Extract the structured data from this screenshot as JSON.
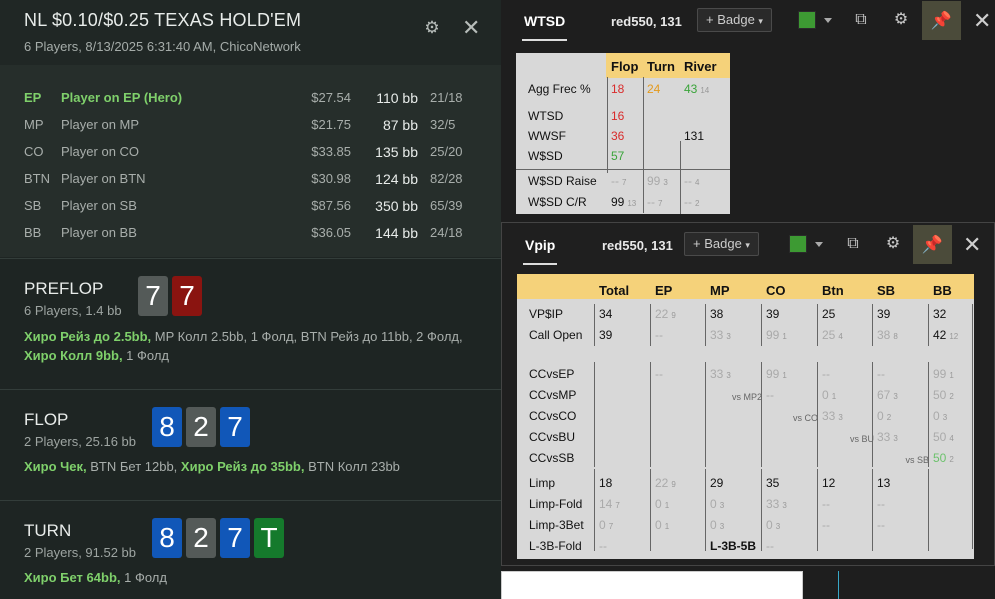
{
  "hand": {
    "title": "NL $0.10/$0.25 TEXAS HOLD'EM",
    "subtitle": "6 Players, 8/13/2025 6:31:40 AM, ChicoNetwork",
    "players": [
      {
        "pos": "EP",
        "name": "Player on EP (Hero)",
        "money": "$27.54",
        "bb": "110 bb",
        "stat": "21/18",
        "hero": true
      },
      {
        "pos": "MP",
        "name": "Player on MP",
        "money": "$21.75",
        "bb": "87 bb",
        "stat": "32/5",
        "hero": false
      },
      {
        "pos": "CO",
        "name": "Player on CO",
        "money": "$33.85",
        "bb": "135 bb",
        "stat": "25/20",
        "hero": false
      },
      {
        "pos": "BTN",
        "name": "Player on BTN",
        "money": "$30.98",
        "bb": "124 bb",
        "stat": "82/28",
        "hero": false
      },
      {
        "pos": "SB",
        "name": "Player on SB",
        "money": "$87.56",
        "bb": "350 bb",
        "stat": "65/39",
        "hero": false
      },
      {
        "pos": "BB",
        "name": "Player on BB",
        "money": "$36.05",
        "bb": "144 bb",
        "stat": "24/18",
        "hero": false
      }
    ],
    "streets": [
      {
        "name": "PREFLOP",
        "sub": "6 Players, 1.4 bb",
        "cards": [
          {
            "v": "7",
            "c": "gray"
          },
          {
            "v": "7",
            "c": "red"
          }
        ],
        "actions": [
          [
            {
              "t": "Хиро Рейз до 2.5bb,",
              "h": true
            },
            {
              "t": " MP Колл 2.5bb, 1 Фолд, BTN Рейз до 11bb, 2 Фолд,",
              "h": false
            }
          ],
          [
            {
              "t": "Хиро Колл 9bb,",
              "h": true
            },
            {
              "t": " 1 Фолд",
              "h": false
            }
          ]
        ]
      },
      {
        "name": "FLOP",
        "sub": "2 Players, 25.16 bb",
        "cards": [
          {
            "v": "8",
            "c": "blue"
          },
          {
            "v": "2",
            "c": "gray"
          },
          {
            "v": "7",
            "c": "blue"
          }
        ],
        "actions": [
          [
            {
              "t": "Хиро Чек,",
              "h": true
            },
            {
              "t": " BTN Бет 12bb, ",
              "h": false
            },
            {
              "t": "Хиро Рейз до 35bb,",
              "h": true
            },
            {
              "t": " BTN Колл 23bb",
              "h": false
            }
          ]
        ]
      },
      {
        "name": "TURN",
        "sub": "2 Players, 91.52 bb",
        "cards": [
          {
            "v": "8",
            "c": "blue"
          },
          {
            "v": "2",
            "c": "gray"
          },
          {
            "v": "7",
            "c": "blue"
          },
          {
            "v": "T",
            "c": "green"
          }
        ],
        "actions": [
          [
            {
              "t": "Хиро Бет 64bb,",
              "h": true
            },
            {
              "t": " 1 Фолд",
              "h": false
            }
          ]
        ]
      }
    ]
  },
  "wtsd": {
    "tab": "WTSD",
    "player": "red550, 131",
    "badge": "+ Badge",
    "headers": [
      "Flop",
      "Turn",
      "River"
    ],
    "rows": [
      {
        "label": "Agg Frec %",
        "cells": [
          {
            "v": "18",
            "s": "",
            "c": "red"
          },
          {
            "v": "24",
            "s": "",
            "c": "orange"
          },
          {
            "v": "43",
            "s": "14",
            "c": "green"
          }
        ]
      },
      {
        "label": "WTSD",
        "cells": [
          {
            "v": "16",
            "s": "",
            "c": "red"
          },
          {
            "v": "",
            "s": "",
            "c": ""
          },
          {
            "v": "",
            "s": "",
            "c": ""
          }
        ]
      },
      {
        "label": "WWSF",
        "cells": [
          {
            "v": "36",
            "s": "",
            "c": "red"
          },
          {
            "v": "",
            "s": "",
            "c": ""
          },
          {
            "v": "131",
            "s": "",
            "c": ""
          }
        ]
      },
      {
        "label": "W$SD",
        "cells": [
          {
            "v": "57",
            "s": "",
            "c": "green"
          },
          {
            "v": "",
            "s": "",
            "c": ""
          },
          {
            "v": "",
            "s": "",
            "c": ""
          }
        ]
      },
      {
        "label": "W$SD Raise",
        "cells": [
          {
            "v": "--",
            "s": "7",
            "c": "gray"
          },
          {
            "v": "99",
            "s": "3",
            "c": "gray"
          },
          {
            "v": "--",
            "s": "4",
            "c": "gray"
          }
        ]
      },
      {
        "label": "W$SD C/R",
        "cells": [
          {
            "v": "99",
            "s": "13",
            "c": ""
          },
          {
            "v": "--",
            "s": "7",
            "c": "gray"
          },
          {
            "v": "--",
            "s": "2",
            "c": "gray"
          }
        ]
      }
    ]
  },
  "vpip": {
    "tab": "Vpip",
    "player": "red550, 131",
    "badge": "+ Badge",
    "headers": [
      "Total",
      "EP",
      "MP",
      "CO",
      "Btn",
      "SB",
      "BB"
    ],
    "rows": [
      {
        "label": "VP$IP",
        "cells": [
          {
            "v": "34",
            "s": "",
            "g": false
          },
          {
            "v": "22",
            "s": "9",
            "g": true
          },
          {
            "v": "38",
            "s": "",
            "g": false
          },
          {
            "v": "39",
            "s": "",
            "g": false
          },
          {
            "v": "25",
            "s": "",
            "g": false
          },
          {
            "v": "39",
            "s": "",
            "g": false
          },
          {
            "v": "32",
            "s": "",
            "g": false
          }
        ]
      },
      {
        "label": "Call Open",
        "cells": [
          {
            "v": "39",
            "s": "",
            "g": false
          },
          {
            "v": "--",
            "s": "",
            "g": true
          },
          {
            "v": "33",
            "s": "3",
            "g": true
          },
          {
            "v": "99",
            "s": "1",
            "g": true
          },
          {
            "v": "25",
            "s": "4",
            "g": true
          },
          {
            "v": "38",
            "s": "8",
            "g": true
          },
          {
            "v": "42",
            "s": "12",
            "g": false
          }
        ]
      },
      {
        "label": "CCvsEP",
        "cells": [
          {
            "v": "",
            "s": "",
            "g": false
          },
          {
            "v": "--",
            "s": "",
            "g": true
          },
          {
            "v": "33",
            "s": "3",
            "g": true
          },
          {
            "v": "99",
            "s": "1",
            "g": true
          },
          {
            "v": "--",
            "s": "",
            "g": true
          },
          {
            "v": "--",
            "s": "",
            "g": true
          },
          {
            "v": "99",
            "s": "1",
            "g": true
          }
        ]
      },
      {
        "label": "CCvsMP",
        "cells": [
          {
            "v": "",
            "s": "",
            "g": false
          },
          {
            "v": "",
            "s": "",
            "g": false
          },
          {
            "v": "vs MP2",
            "s": "",
            "g": false,
            "note": true
          },
          {
            "v": "--",
            "s": "",
            "g": true
          },
          {
            "v": "0",
            "s": "1",
            "g": true
          },
          {
            "v": "67",
            "s": "3",
            "g": true
          },
          {
            "v": "50",
            "s": "2",
            "g": true
          }
        ]
      },
      {
        "label": "CCvsCO",
        "cells": [
          {
            "v": "",
            "s": "",
            "g": false
          },
          {
            "v": "",
            "s": "",
            "g": false
          },
          {
            "v": "",
            "s": "",
            "g": false
          },
          {
            "v": "vs CO",
            "s": "",
            "g": false,
            "note": true
          },
          {
            "v": "33",
            "s": "3",
            "g": true
          },
          {
            "v": "0",
            "s": "2",
            "g": true
          },
          {
            "v": "0",
            "s": "3",
            "g": true
          }
        ]
      },
      {
        "label": "CCvsBU",
        "cells": [
          {
            "v": "",
            "s": "",
            "g": false
          },
          {
            "v": "",
            "s": "",
            "g": false
          },
          {
            "v": "",
            "s": "",
            "g": false
          },
          {
            "v": "",
            "s": "",
            "g": false
          },
          {
            "v": "vs BU",
            "s": "",
            "g": false,
            "note": true
          },
          {
            "v": "33",
            "s": "3",
            "g": true
          },
          {
            "v": "50",
            "s": "4",
            "g": true
          }
        ]
      },
      {
        "label": "CCvsSB",
        "cells": [
          {
            "v": "",
            "s": "",
            "g": false
          },
          {
            "v": "",
            "s": "",
            "g": false
          },
          {
            "v": "",
            "s": "",
            "g": false
          },
          {
            "v": "",
            "s": "",
            "g": false
          },
          {
            "v": "",
            "s": "",
            "g": false
          },
          {
            "v": "vs SB",
            "s": "",
            "g": false,
            "note": true
          },
          {
            "v": "50",
            "s": "2",
            "g": true,
            "green": true
          }
        ]
      },
      {
        "label": "Limp",
        "cells": [
          {
            "v": "18",
            "s": "",
            "g": false
          },
          {
            "v": "22",
            "s": "9",
            "g": true
          },
          {
            "v": "29",
            "s": "",
            "g": false
          },
          {
            "v": "35",
            "s": "",
            "g": false
          },
          {
            "v": "12",
            "s": "",
            "g": false
          },
          {
            "v": "13",
            "s": "",
            "g": false
          },
          {
            "v": "",
            "s": "",
            "g": false
          }
        ]
      },
      {
        "label": "Limp-Fold",
        "cells": [
          {
            "v": "14",
            "s": "7",
            "g": true
          },
          {
            "v": "0",
            "s": "1",
            "g": true
          },
          {
            "v": "0",
            "s": "3",
            "g": true
          },
          {
            "v": "33",
            "s": "3",
            "g": true
          },
          {
            "v": "--",
            "s": "",
            "g": true
          },
          {
            "v": "--",
            "s": "",
            "g": true
          },
          {
            "v": "",
            "s": "",
            "g": false
          }
        ]
      },
      {
        "label": "Limp-3Bet",
        "cells": [
          {
            "v": "0",
            "s": "7",
            "g": true
          },
          {
            "v": "0",
            "s": "1",
            "g": true
          },
          {
            "v": "0",
            "s": "3",
            "g": true
          },
          {
            "v": "0",
            "s": "3",
            "g": true
          },
          {
            "v": "--",
            "s": "",
            "g": true
          },
          {
            "v": "--",
            "s": "",
            "g": true
          },
          {
            "v": "",
            "s": "",
            "g": false
          }
        ]
      },
      {
        "label": "L-3B-Fold",
        "cells": [
          {
            "v": "--",
            "s": "",
            "g": true
          },
          {
            "v": "",
            "s": "",
            "g": false
          },
          {
            "v": "L-3B-5B",
            "s": "",
            "g": false,
            "bold": true
          },
          {
            "v": "--",
            "s": "",
            "g": true
          },
          {
            "v": "",
            "s": "",
            "g": false
          },
          {
            "v": "",
            "s": "",
            "g": false
          },
          {
            "v": "",
            "s": "",
            "g": false
          }
        ]
      }
    ]
  },
  "icons": {
    "settings": "gear-icon",
    "close": "close-icon",
    "copy": "copy-icon",
    "pin": "pin-icon"
  },
  "colors": {
    "hero": "#7fd06b",
    "header_yellow": "#f5d27a",
    "swatch": "#3d9a33",
    "red": "#d92b2b",
    "orange": "#e39a1e",
    "green": "#3aa43a"
  }
}
